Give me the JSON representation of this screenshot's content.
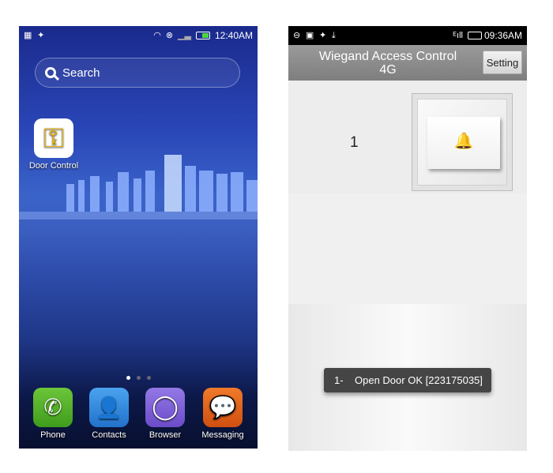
{
  "left_screen": {
    "status_bar": {
      "time": "12:40AM",
      "icons": [
        "apps-icon",
        "pin-icon",
        "wifi-icon",
        "sim-blocked-icon",
        "signal-icon",
        "battery-icon"
      ]
    },
    "search": {
      "placeholder": "Search"
    },
    "apps": [
      {
        "label": "Door Control",
        "icon": "keys-icon"
      }
    ],
    "page_indicator": {
      "pages": 3,
      "current": 1
    },
    "dock": [
      {
        "label": "Phone",
        "icon": "phone-icon",
        "color": "#4caf23"
      },
      {
        "label": "Contacts",
        "icon": "contacts-icon",
        "color": "#2f8de0"
      },
      {
        "label": "Browser",
        "icon": "browser-icon",
        "color": "#7c5cd6"
      },
      {
        "label": "Messaging",
        "icon": "messaging-icon",
        "color": "#e8601a"
      }
    ]
  },
  "right_screen": {
    "status_bar": {
      "time": "09:36AM",
      "icons": [
        "chat-icon",
        "image-icon",
        "pin-icon",
        "download-icon",
        "signal-e-icon",
        "battery-icon"
      ]
    },
    "header": {
      "title_line1": "Wiegand Access Control",
      "title_line2": "4G",
      "setting_label": "Setting"
    },
    "door": {
      "number": "1",
      "icon": "doorbell-switch-icon"
    },
    "toast": {
      "text": "1-    Open Door OK [223175035]"
    }
  }
}
